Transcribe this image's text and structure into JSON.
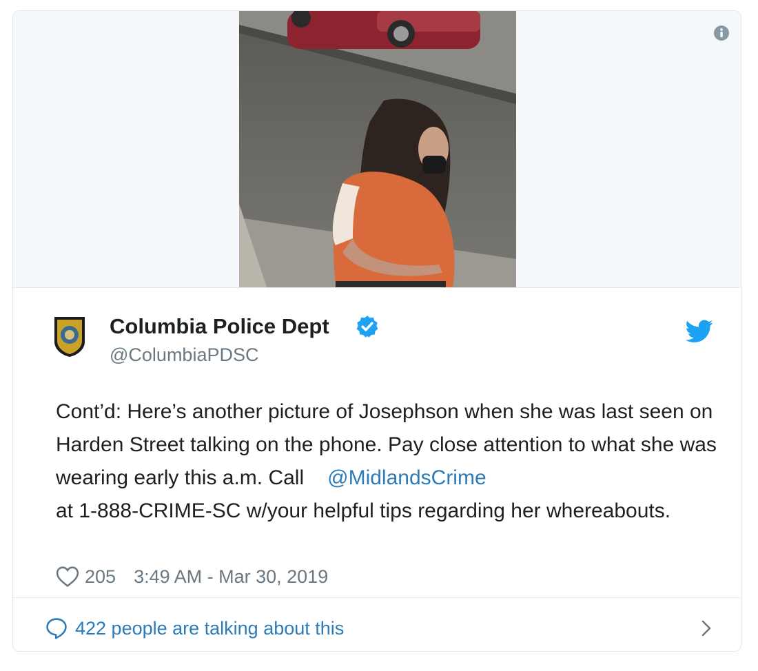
{
  "tweet": {
    "author_name": "Columbia Police Dept",
    "handle": "@ColumbiaPDSC",
    "text_before_mention": "Cont’d: Here’s another picture of Josephson when she was last seen on Harden Street talking on the phone. Pay close attention to what she was wearing early this a.m. Call",
    "mention": "@MidlandsCrime",
    "text_after_mention": "at 1-888-CRIME-SC w/your helpful tips regarding her whereabouts.",
    "like_count": "205",
    "timestamp": "3:49 AM - Mar 30, 2019",
    "conversation_label": "422 people are talking about this"
  },
  "icons": {
    "info": "info-icon",
    "verified": "verified-badge-icon",
    "platform": "twitter-bird-icon",
    "like": "heart-icon",
    "reply": "speech-bubble-icon",
    "open": "chevron-right-icon"
  },
  "colors": {
    "link": "#2b7bb9",
    "verified": "#1da1f2",
    "secondary_text": "#697882",
    "border": "#e1e8ed"
  }
}
